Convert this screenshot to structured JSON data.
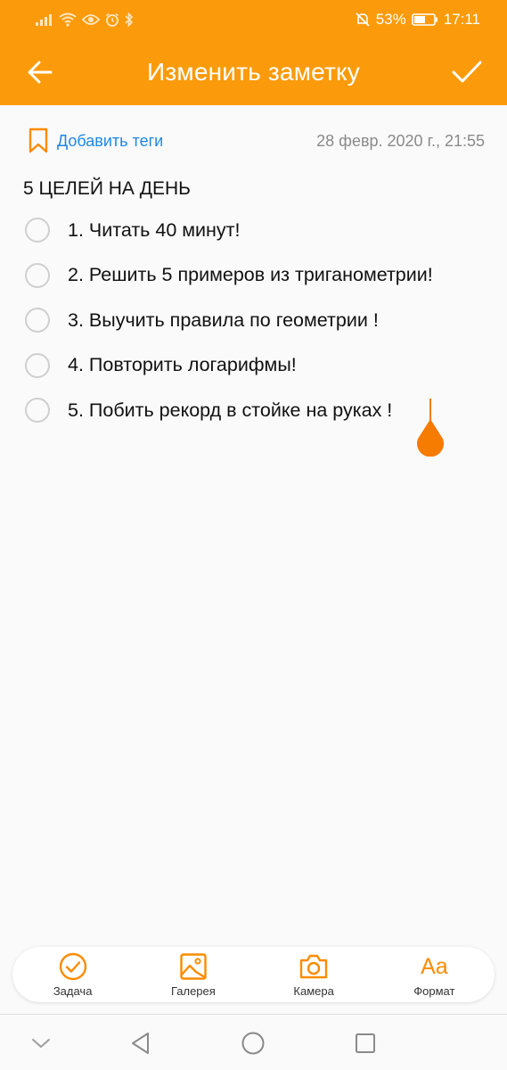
{
  "status_bar": {
    "battery": "53%",
    "time": "17:11"
  },
  "header": {
    "title": "Изменить заметку",
    "back_icon": "arrow-left-icon",
    "done_icon": "checkmark-icon"
  },
  "meta": {
    "add_tags_label": "Добавить теги",
    "date": "28 февр. 2020 г., 21:55"
  },
  "note": {
    "title": "5 ЦЕЛЕЙ НА ДЕНЬ",
    "tasks": [
      {
        "text": "1. Читать 40 минут!",
        "checked": false
      },
      {
        "text": "2. Решить 5 примеров из триганометрии!",
        "checked": false
      },
      {
        "text": "3. Выучить правила по геометрии !",
        "checked": false
      },
      {
        "text": "4. Повторить логарифмы!",
        "checked": false
      },
      {
        "text": "5. Побить рекорд в стойке на руках !",
        "checked": false
      }
    ]
  },
  "toolbar": {
    "task_label": "Задача",
    "gallery_label": "Галерея",
    "camera_label": "Камера",
    "format_label": "Формат",
    "format_glyph": "Aa"
  },
  "colors": {
    "accent": "#fb9b0b",
    "icon_orange": "#fb8c00",
    "link_blue": "#1e88e5",
    "cursor": "#f57c00"
  }
}
